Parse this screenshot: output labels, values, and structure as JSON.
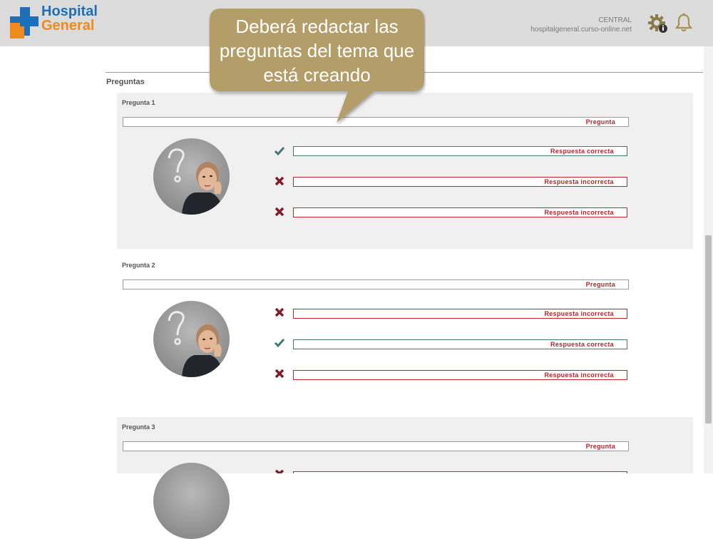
{
  "header": {
    "logo": {
      "line1": "Hospital",
      "line2": "General"
    },
    "site_name": "CENTRAL",
    "site_url": "hospitalgeneral.curso-online.net",
    "icons": [
      "gear-info-icon",
      "bell-icon"
    ],
    "colors": {
      "logo_blue": "#1f6fb8",
      "logo_orange": "#f08a1c",
      "accent_red": "#b3262f",
      "correct_teal": "#3e7a72"
    }
  },
  "callout": {
    "text": "Deberá redactar las preguntas del tema que está creando"
  },
  "section": {
    "title": "Preguntas"
  },
  "questions": [
    {
      "title": "Pregunta 1",
      "field": "Pregunta",
      "answers": [
        {
          "status": "correct",
          "label": "Respuesta correcta"
        },
        {
          "status": "incorrect",
          "label": "Respuesta incorrecta"
        },
        {
          "status": "incorrect",
          "label": "Respuesta incorrecta"
        }
      ]
    },
    {
      "title": "Pregunta 2",
      "field": "Pregunta",
      "answers": [
        {
          "status": "incorrect",
          "label": "Respuesta incorrecta"
        },
        {
          "status": "correct",
          "label": "Respuesta correcta"
        },
        {
          "status": "incorrect",
          "label": "Respuesta incorrecta"
        }
      ]
    },
    {
      "title": "Pregunta 3",
      "field": "Pregunta",
      "answers": []
    }
  ]
}
